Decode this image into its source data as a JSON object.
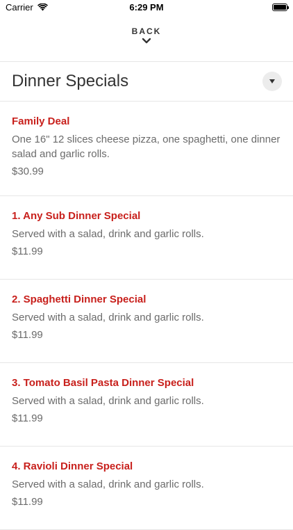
{
  "status_bar": {
    "carrier": "Carrier",
    "time": "6:29 PM"
  },
  "nav": {
    "back_label": "BACK"
  },
  "section": {
    "title": "Dinner Specials"
  },
  "colors": {
    "accent": "#c8201c",
    "text_muted": "#6b6b6b",
    "divider": "#e6e6e6"
  },
  "items": [
    {
      "name": "Family Deal",
      "description": "One 16\" 12 slices cheese pizza, one spaghetti, one dinner salad and garlic rolls.",
      "price": "$30.99"
    },
    {
      "name": "1. Any Sub Dinner Special",
      "description": "Served with a salad, drink and garlic rolls.",
      "price": "$11.99"
    },
    {
      "name": "2. Spaghetti Dinner Special",
      "description": "Served with a salad, drink and garlic rolls.",
      "price": "$11.99"
    },
    {
      "name": "3. Tomato Basil Pasta Dinner Special",
      "description": "Served with a salad, drink and garlic rolls.",
      "price": "$11.99"
    },
    {
      "name": "4. Ravioli Dinner Special",
      "description": "Served with a salad, drink and garlic rolls.",
      "price": "$11.99"
    }
  ]
}
